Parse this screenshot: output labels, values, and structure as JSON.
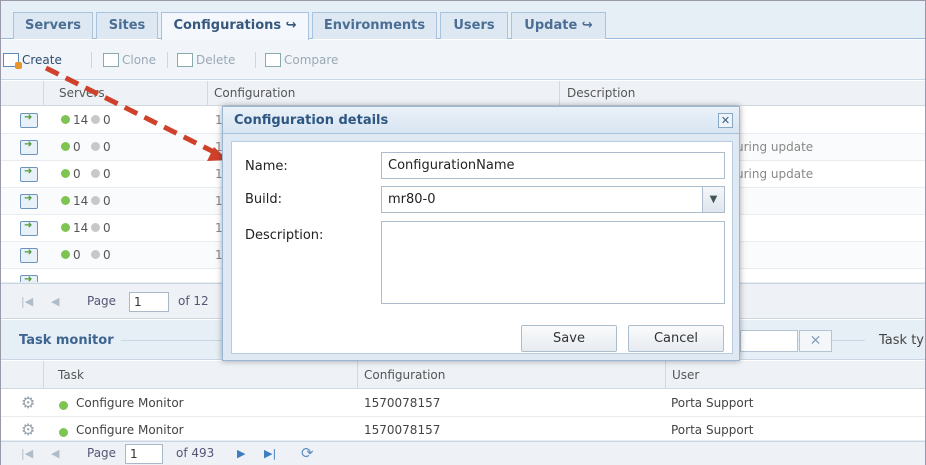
{
  "tabs": [
    {
      "label": "Servers"
    },
    {
      "label": "Sites"
    },
    {
      "label": "Configurations ↪"
    },
    {
      "label": "Environments"
    },
    {
      "label": "Users"
    },
    {
      "label": "Update ↪"
    }
  ],
  "active_tab": "Configurations",
  "toolbar": {
    "create": "Create",
    "clone": "Clone",
    "delete": "Delete",
    "compare": "Compare"
  },
  "grid": {
    "columns": [
      "Servers",
      "Configuration",
      "Description"
    ],
    "rows": [
      {
        "green": "14",
        "grey": "0",
        "cfg": "1",
        "desc": ""
      },
      {
        "green": "0",
        "grey": "0",
        "cfg": "1",
        "desc": "uring update"
      },
      {
        "green": "0",
        "grey": "0",
        "cfg": "1",
        "desc": "uring update"
      },
      {
        "green": "14",
        "grey": "0",
        "cfg": "1",
        "desc": ""
      },
      {
        "green": "14",
        "grey": "0",
        "cfg": "1",
        "desc": ""
      },
      {
        "green": "0",
        "grey": "0",
        "cfg": "1",
        "desc": ""
      }
    ]
  },
  "pager1": {
    "page_label": "Page",
    "page": "1",
    "of": "of 12"
  },
  "task_monitor": {
    "title": "Task monitor",
    "task_type_label": "Task ty",
    "clear_icon": "✕",
    "columns": [
      "Task",
      "Configuration",
      "User"
    ],
    "rows": [
      {
        "task": "Configure Monitor",
        "cfg": "1570078157",
        "user": "Porta Support"
      },
      {
        "task": "Configure Monitor",
        "cfg": "1570078157",
        "user": "Porta Support"
      }
    ]
  },
  "pager2": {
    "page_label": "Page",
    "page": "1",
    "of": "of 493"
  },
  "modal": {
    "title": "Configuration details",
    "name_label": "Name:",
    "name_value": "ConfigurationName",
    "build_label": "Build:",
    "build_value": "mr80-0",
    "description_label": "Description:",
    "description_value": "",
    "save": "Save",
    "cancel": "Cancel",
    "close_icon": "✕"
  },
  "icons": {
    "row_icon": "apply-config-icon",
    "task_icon": "gear-icon",
    "annotation": "red-dashed-arrow"
  },
  "colors": {
    "accent": "#3d6590",
    "status_green": "#7ec453",
    "status_grey": "#c8c8c8",
    "arrow": "#d0412b"
  }
}
